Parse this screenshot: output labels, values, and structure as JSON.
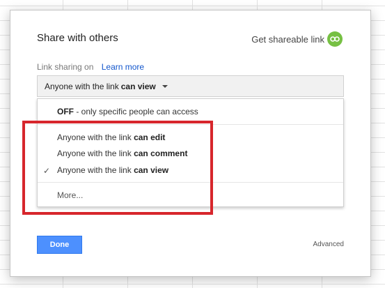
{
  "dialog": {
    "title": "Share with others",
    "shareable_link_label": "Get shareable link",
    "link_sharing_label": "Link sharing on",
    "learn_more": "Learn more",
    "dropdown": {
      "prefix": "Anyone with the link",
      "selected": "can view"
    },
    "menu": {
      "off": {
        "bold": "OFF",
        "rest": " - only specific people can access"
      },
      "items": [
        {
          "prefix": "Anyone with the link",
          "bold": "can edit",
          "checked": false
        },
        {
          "prefix": "Anyone with the link",
          "bold": "can comment",
          "checked": false
        },
        {
          "prefix": "Anyone with the link",
          "bold": "can view",
          "checked": true
        }
      ],
      "check_mark": "✓",
      "more": "More..."
    },
    "done_label": "Done",
    "advanced_label": "Advanced"
  },
  "colors": {
    "accent_blue": "#4d90fe",
    "link_green": "#76c043",
    "highlight_red": "#d7262c"
  }
}
